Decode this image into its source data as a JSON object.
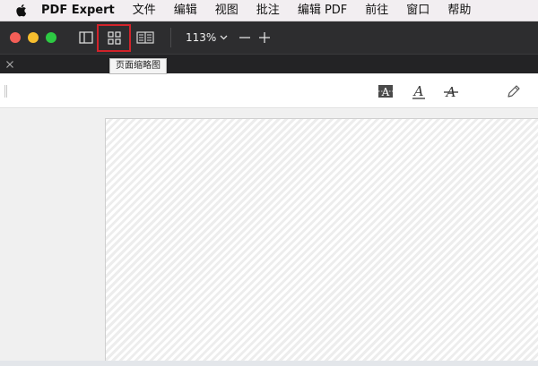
{
  "menubar": {
    "apple_icon": "apple-logo-icon",
    "items": [
      {
        "label": "PDF Expert"
      },
      {
        "label": "文件"
      },
      {
        "label": "编辑"
      },
      {
        "label": "视图"
      },
      {
        "label": "批注"
      },
      {
        "label": "编辑 PDF"
      },
      {
        "label": "前往"
      },
      {
        "label": "窗口"
      },
      {
        "label": "帮助"
      }
    ]
  },
  "toolbar": {
    "icons": {
      "sidebar": "sidebar-icon",
      "thumbnails": "page-thumbnails-icon",
      "reader": "reading-mode-icon",
      "zoom_out": "minus-icon",
      "zoom_in": "plus-icon"
    },
    "zoom_value": "113%",
    "highlight_color": "#d2232a"
  },
  "tooltip": {
    "text": "页面缩略图"
  },
  "tabstrip": {
    "close_icon": "close-icon"
  },
  "annotation_bar": {
    "icons": [
      "text-box-icon",
      "underline-text-icon",
      "strikethrough-text-icon",
      "pen-icon"
    ]
  }
}
